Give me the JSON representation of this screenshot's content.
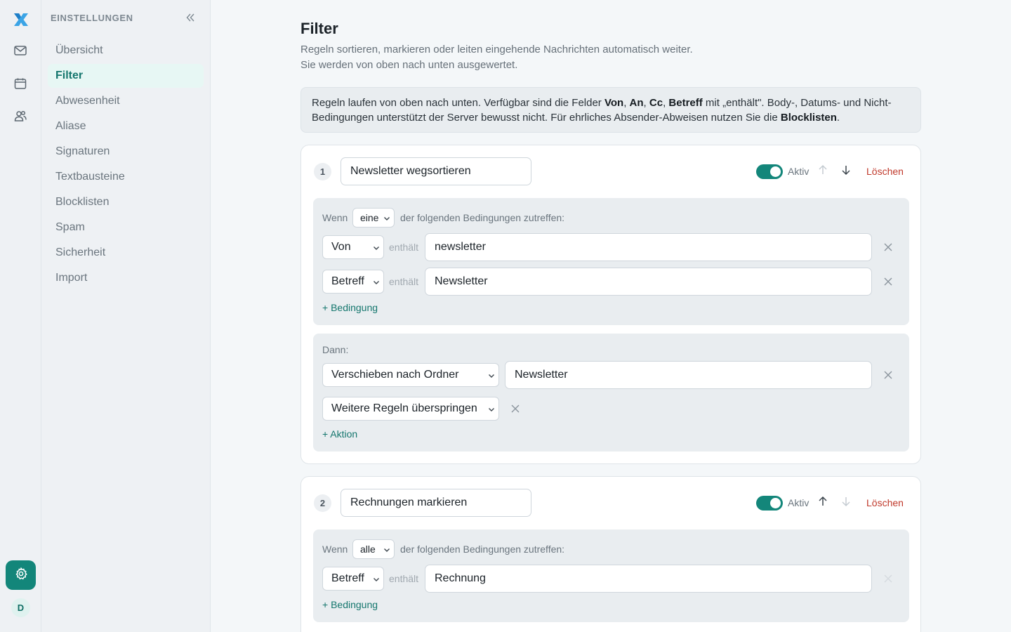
{
  "rail": {
    "logo": "app-logo",
    "avatar": "D",
    "icons": [
      "mail-icon",
      "calendar-icon",
      "contacts-icon",
      "gear-icon"
    ]
  },
  "sidebar": {
    "title": "EINSTELLUNGEN",
    "items": [
      {
        "label": "Übersicht"
      },
      {
        "label": "Filter"
      },
      {
        "label": "Abwesenheit"
      },
      {
        "label": "Aliase"
      },
      {
        "label": "Signaturen"
      },
      {
        "label": "Textbausteine"
      },
      {
        "label": "Blocklisten"
      },
      {
        "label": "Spam"
      },
      {
        "label": "Sicherheit"
      },
      {
        "label": "Import"
      }
    ]
  },
  "main": {
    "title": "Filter",
    "subtitle_line1": "Regeln sortieren, markieren oder leiten eingehende Nachrichten automatisch weiter.",
    "subtitle_line2": "Sie werden von oben nach unten ausgewertet.",
    "info": {
      "t1": "Regeln laufen von oben nach unten. Verfügbar sind die Felder ",
      "f1": "Von",
      "c1": ", ",
      "f2": "An",
      "c2": ", ",
      "f3": "Cc",
      "c3": ", ",
      "f4": "Betreff",
      "t2": " mit „enthält\". Body-, Datums- und Nicht-Bedingungen unterstützt der Server bewusst nicht. Für ehrliches Absender-Abweisen nutzen Sie die ",
      "f5": "Blocklisten",
      "t3": "."
    }
  },
  "rules": [
    {
      "number": "1",
      "name": "Newsletter wegsortieren",
      "toggle_label": "Aktiv",
      "delete_label": "Löschen",
      "when_label": "Wenn",
      "match": "eine",
      "conditions_suffix": "der folgenden Bedingungen zutreffen:",
      "conditions": [
        {
          "field": "Von",
          "operator": "enthält",
          "value": "newsletter"
        },
        {
          "field": "Betreff",
          "operator": "enthält",
          "value": "Newsletter"
        }
      ],
      "add_condition": "+ Bedingung",
      "then_label": "Dann:",
      "actions": [
        {
          "action": "Verschieben nach Ordner",
          "value": "Newsletter"
        },
        {
          "action": "Weitere Regeln überspringen"
        }
      ],
      "add_action": "+ Aktion"
    },
    {
      "number": "2",
      "name": "Rechnungen markieren",
      "toggle_label": "Aktiv",
      "delete_label": "Löschen",
      "when_label": "Wenn",
      "match": "alle",
      "conditions_suffix": "der folgenden Bedingungen zutreffen:",
      "conditions": [
        {
          "field": "Betreff",
          "operator": "enthält",
          "value": "Rechnung"
        }
      ],
      "add_condition": "+ Bedingung"
    }
  ],
  "colors": {
    "accent": "#13867a",
    "danger": "#c0392b"
  }
}
